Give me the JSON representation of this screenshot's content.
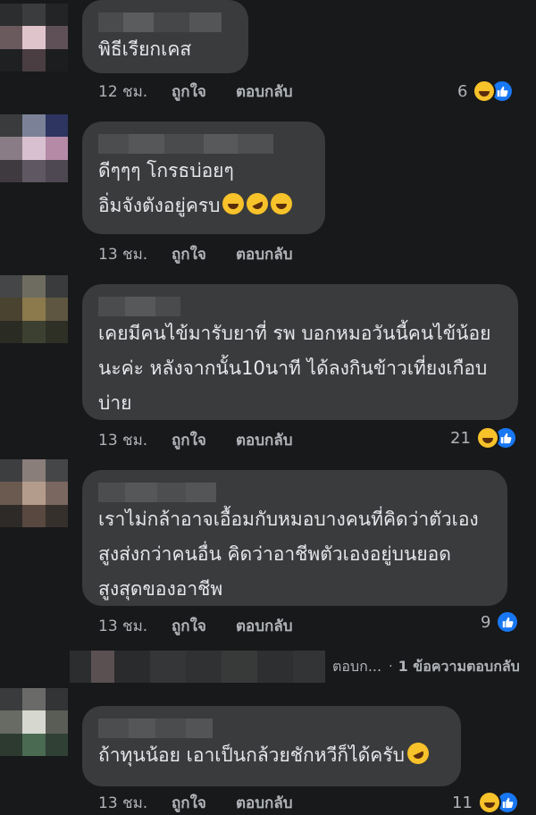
{
  "comments": [
    {
      "text": "พิธีเรียกเคส",
      "time": "12 ชม.",
      "like_label": "ถูกใจ",
      "reply_label": "ตอบกลับ",
      "reaction_count": "6",
      "reactions": [
        "laugh-icon",
        "like-icon"
      ]
    },
    {
      "text": "ดีๆๆๆ โกรธบ่อยๆ\nอิ่มจังตังอยู่ครบ",
      "emojis": [
        "grin-emoji",
        "rofl-emoji",
        "tears-of-joy-emoji"
      ],
      "time": "13 ชม.",
      "like_label": "ถูกใจ",
      "reply_label": "ตอบกลับ"
    },
    {
      "text": "เคยมีคนไข้มารับยาที่ รพ บอกหมอวันนี้คนไข้น้อย\nนะค่ะ  หลังจากนั้น10นาที ได้ลงกินข้าวเที่ยงเกือบ\nบ่าย",
      "time": "13 ชม.",
      "like_label": "ถูกใจ",
      "reply_label": "ตอบกลับ",
      "reaction_count": "21",
      "reactions": [
        "laugh-icon",
        "like-icon"
      ]
    },
    {
      "text": "เราไม่กล้าอาจเอื้อมกับหมอบางคนที่คิดว่าตัวเอง\nสูงส่งกว่าคนอื่น คิดว่าอาชีพตัวเองอยู่บนยอด\nสูงสุดของอาชีพ",
      "time": "13 ชม.",
      "like_label": "ถูกใจ",
      "reply_label": "ตอบกลับ",
      "reaction_count": "9",
      "reactions": [
        "like-icon"
      ],
      "thread": {
        "author_reply": "ตอบก...",
        "separator": "·",
        "view_replies": "1 ข้อความตอบกลับ"
      }
    },
    {
      "text": "ถ้าทุนน้อย เอาเป็นกล้วยชักหวีก็ได้ครับ",
      "emojis": [
        "rofl-emoji"
      ],
      "time": "13 ชม.",
      "like_label": "ถูกใจ",
      "reply_label": "ตอบกลับ",
      "reaction_count": "11",
      "reactions": [
        "laugh-icon",
        "like-icon"
      ]
    }
  ],
  "colors": {
    "background": "#18191a",
    "bubble": "#3a3b3c",
    "text": "#e4e6eb",
    "secondary_text": "#b0b3b8",
    "like_blue": "#1877f2",
    "laugh_yellow": "#f7c22a"
  }
}
